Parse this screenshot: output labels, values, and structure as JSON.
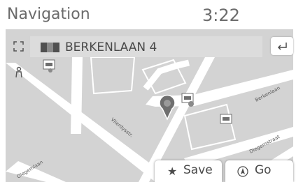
{
  "header": {
    "title": "Navigation",
    "time": "3:22"
  },
  "destination": {
    "label": "BERKENLAAN 4",
    "flag_colors": [
      "#505050",
      "#8a8a8a",
      "#505050"
    ]
  },
  "map": {
    "street_labels": [
      "Berkenlaan",
      "Vlierdysstr.",
      "Diegemstraat",
      "Olegemlaan"
    ],
    "icons": [
      "fullscreen-icon",
      "person-icon",
      "poi-icon",
      "destination-pin-icon"
    ]
  },
  "actions": {
    "back_icon": "return-arrow-icon",
    "save_label": "Save",
    "save_icon": "star-icon",
    "go_label": "Go",
    "go_icon": "navigate-icon"
  },
  "colors": {
    "map_background": "#d3d3d3",
    "road": "#ffffff",
    "text": "#4a4a4a"
  }
}
